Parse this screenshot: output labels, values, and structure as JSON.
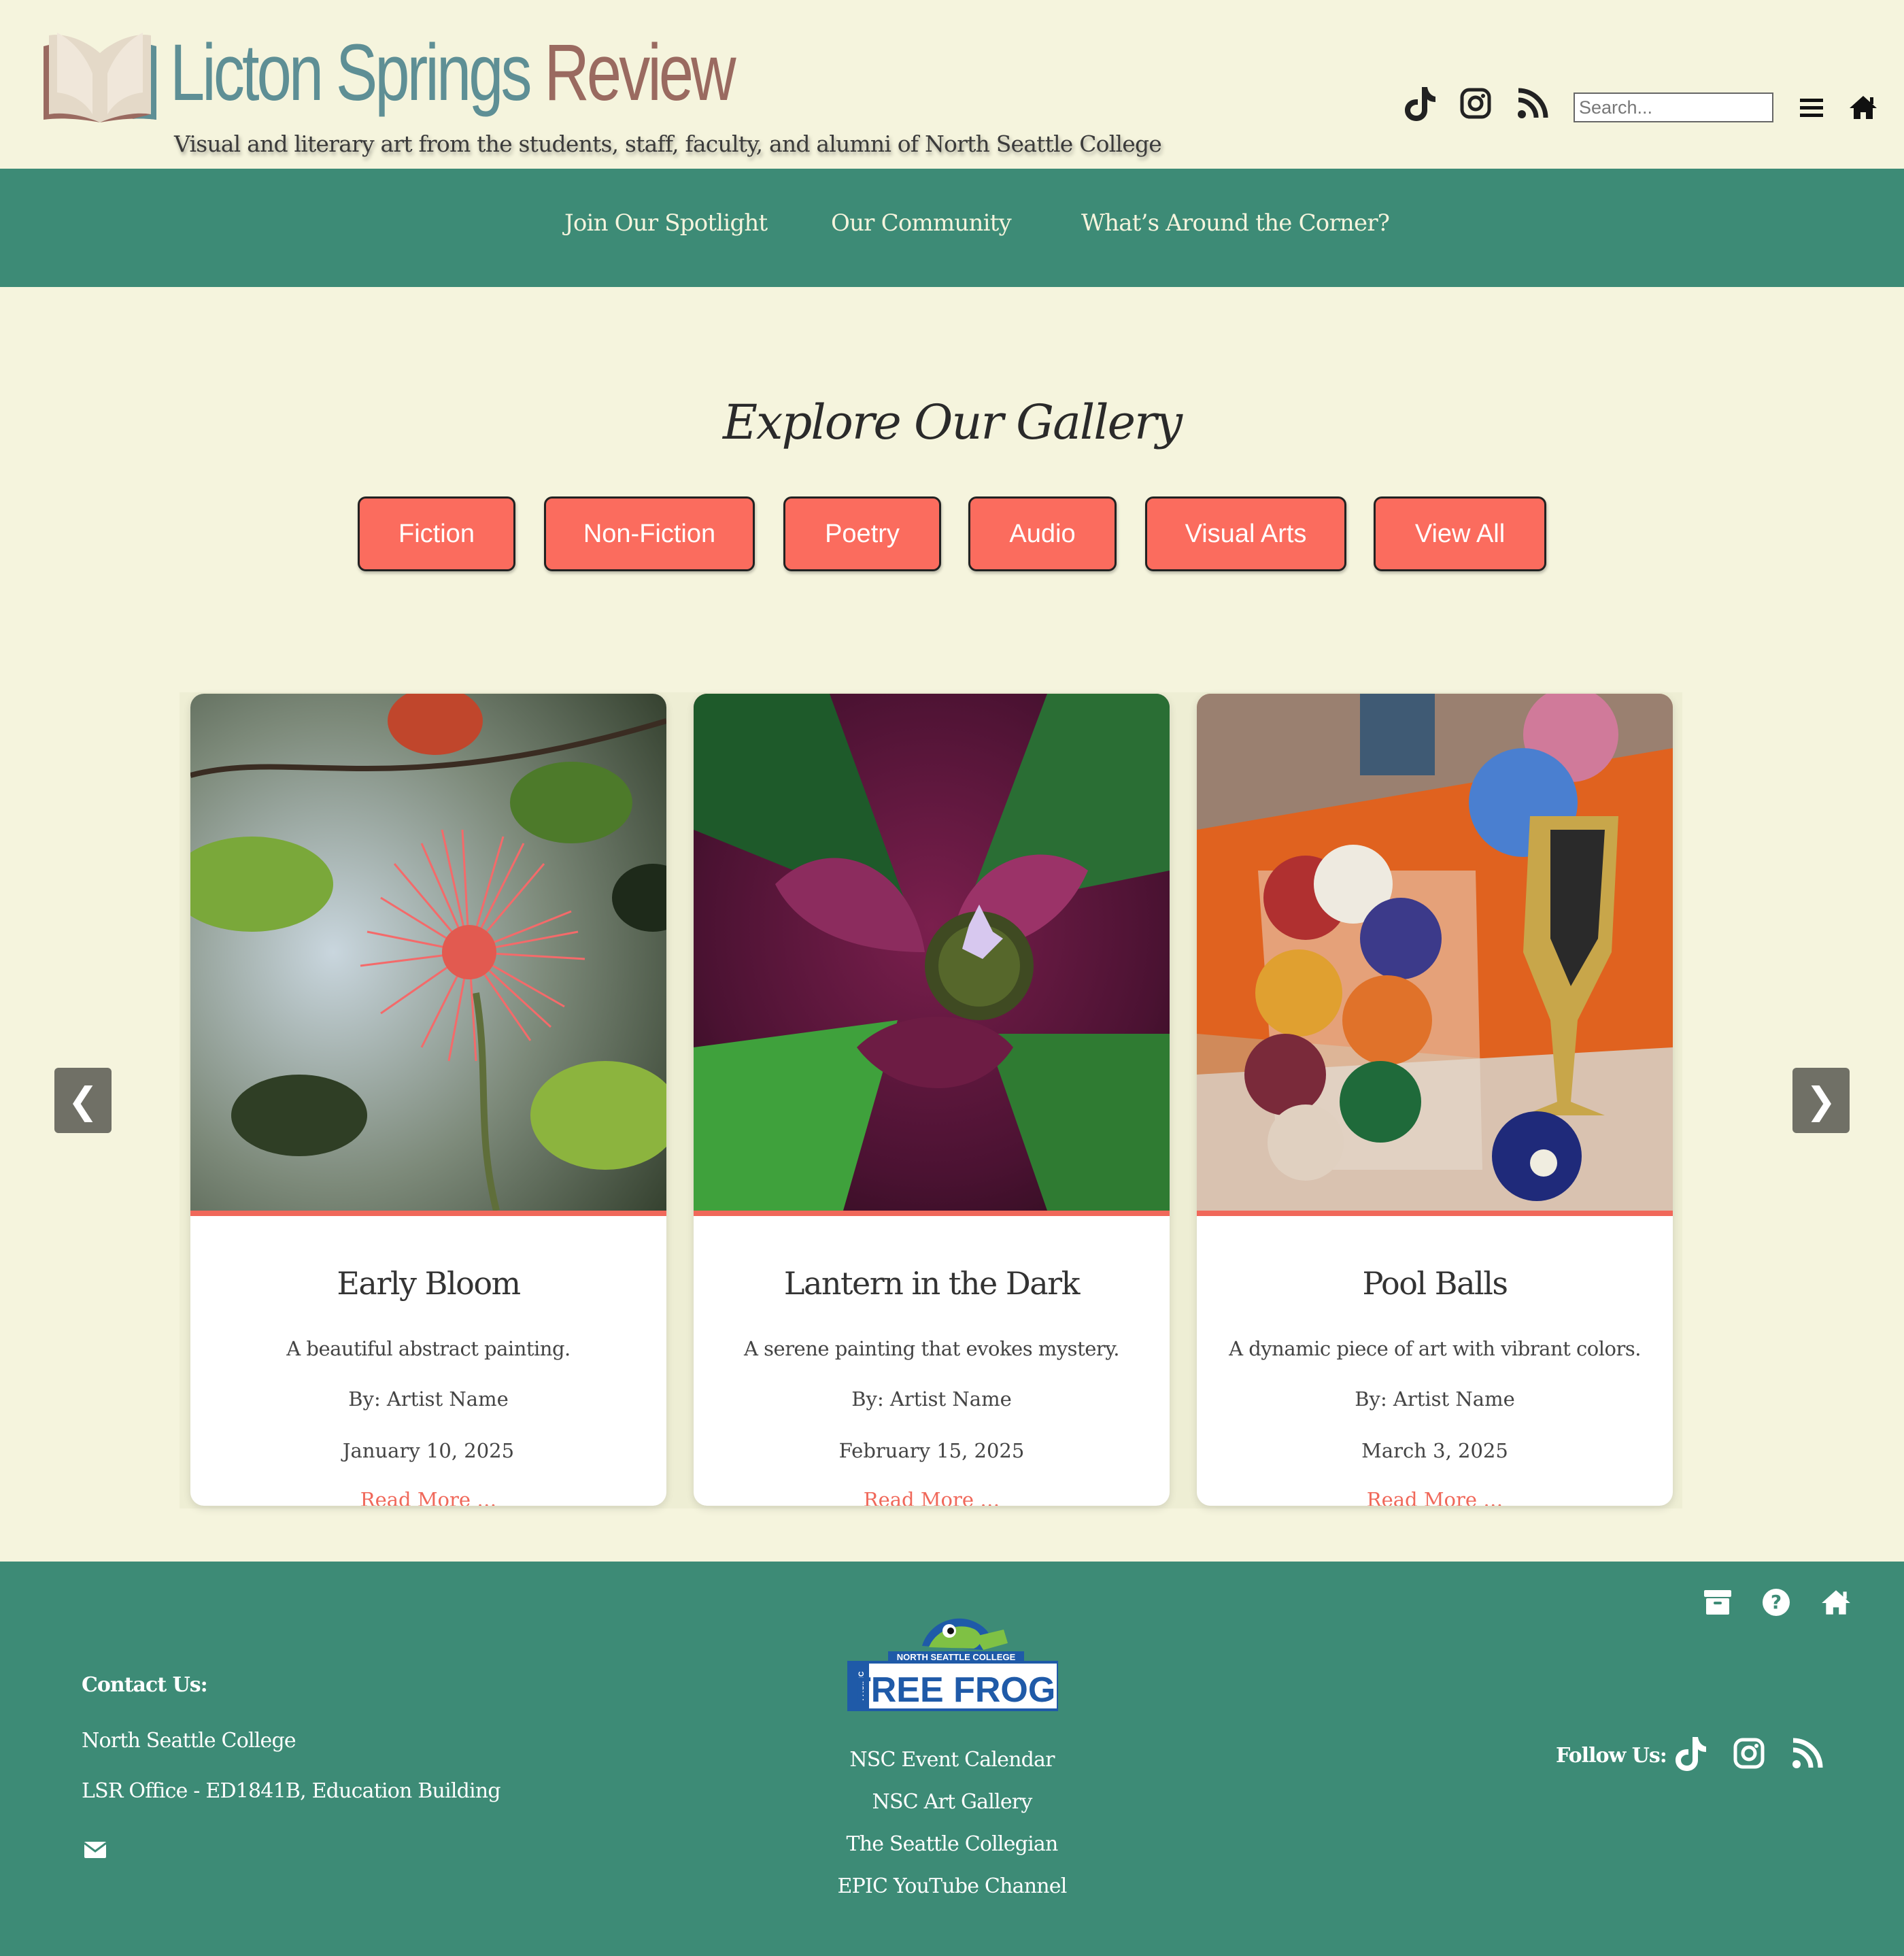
{
  "header": {
    "title_part1": "Licton Springs",
    "title_part2": "Review",
    "tagline": "Visual and literary art from the students, staff, faculty, and alumni of North Seattle College",
    "search_placeholder": "Search...",
    "icons": [
      "tiktok-icon",
      "instagram-icon",
      "rss-icon",
      "menu-icon",
      "home-icon"
    ]
  },
  "nav": {
    "items": [
      "Join Our Spotlight",
      "Our Community",
      "What’s Around the Corner?"
    ]
  },
  "gallery": {
    "title": "Explore Our Gallery",
    "filters": [
      "Fiction",
      "Non-Fiction",
      "Poetry",
      "Audio",
      "Visual Arts",
      "View All"
    ],
    "prev": "❮",
    "next": "❯",
    "cards": [
      {
        "title": "Early Bloom",
        "desc": "A beautiful abstract painting.",
        "by": "By: Artist Name",
        "date": "January 10, 2025",
        "more": "Read More …"
      },
      {
        "title": "Lantern in the Dark",
        "desc": "A serene painting that evokes mystery.",
        "by": "By: Artist Name",
        "date": "February 15, 2025",
        "more": "Read More …"
      },
      {
        "title": "Pool Balls",
        "desc": "A dynamic piece of art with vibrant colors.",
        "by": "By: Artist Name",
        "date": "March 3, 2025",
        "more": "Read More …"
      }
    ]
  },
  "footer": {
    "contact_heading": "Contact Us:",
    "contact_lines": [
      "North Seattle College",
      "LSR Office - ED1841B, Education Building"
    ],
    "logo": {
      "top": "NORTH SEATTLE COLLEGE",
      "main": "TREE FROGS",
      "side": "PACIFIC"
    },
    "links": [
      "NSC Event Calendar",
      "NSC Art Gallery",
      "The Seattle Collegian",
      "EPIC YouTube Channel"
    ],
    "follow_label": "Follow Us:",
    "top_icons": [
      "archive-icon",
      "question-icon",
      "home-icon"
    ]
  },
  "colors": {
    "background": "#f5f4dd",
    "teal": "#3d8b76",
    "coral": "#fb6c5e",
    "title_blue": "#5e8f95",
    "title_brown": "#9a6a60"
  }
}
